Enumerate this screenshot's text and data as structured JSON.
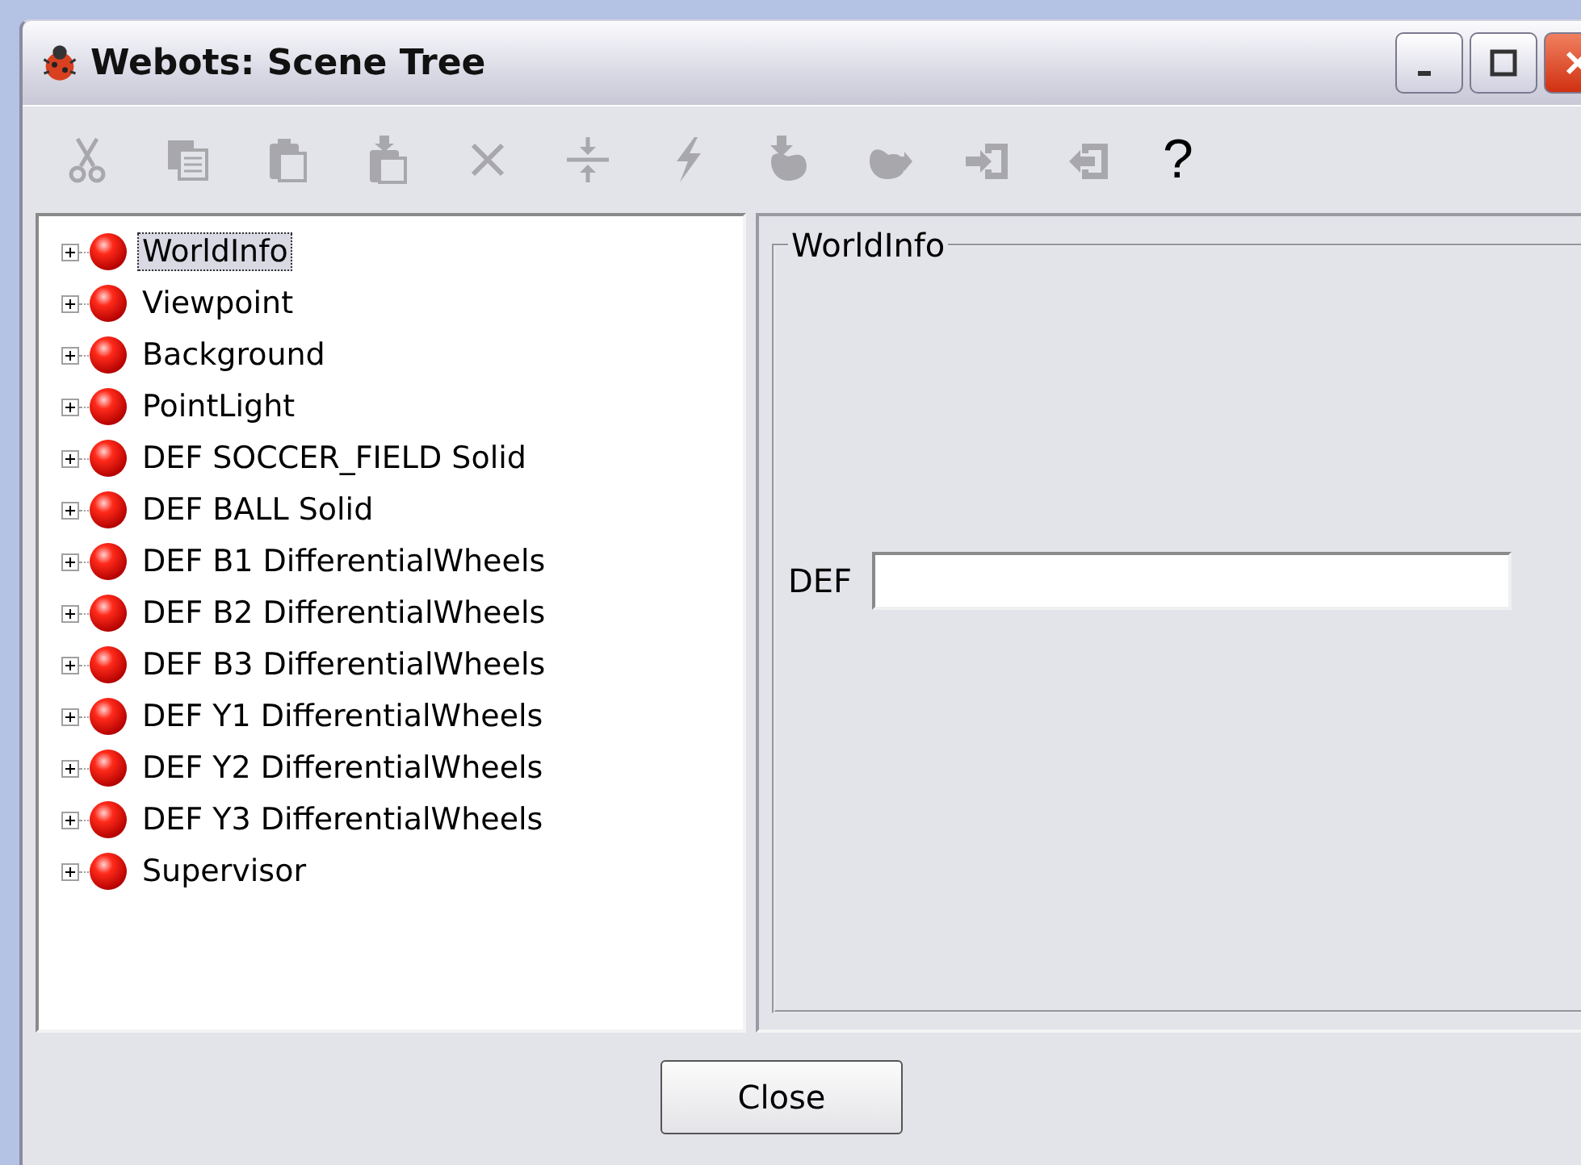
{
  "window": {
    "title": "Webots: Scene Tree"
  },
  "toolbar": [
    {
      "kind": "cut",
      "disabled": true
    },
    {
      "kind": "copy",
      "disabled": true
    },
    {
      "kind": "paste",
      "disabled": true
    },
    {
      "kind": "paste-after",
      "disabled": true
    },
    {
      "kind": "delete",
      "disabled": true
    },
    {
      "kind": "reset",
      "disabled": true
    },
    {
      "kind": "transform",
      "disabled": true
    },
    {
      "kind": "import",
      "disabled": true
    },
    {
      "kind": "export",
      "disabled": true
    },
    {
      "kind": "enter",
      "disabled": true
    },
    {
      "kind": "leave",
      "disabled": true
    },
    {
      "kind": "text",
      "label": "?",
      "disabled": false
    }
  ],
  "tree": [
    {
      "label": "WorldInfo",
      "expanded": false,
      "selected": true
    },
    {
      "label": "Viewpoint",
      "expanded": false,
      "selected": false
    },
    {
      "label": "Background",
      "expanded": false,
      "selected": false
    },
    {
      "label": "PointLight",
      "expanded": false,
      "selected": false
    },
    {
      "label": "DEF SOCCER_FIELD Solid",
      "expanded": false,
      "selected": false
    },
    {
      "label": "DEF BALL Solid",
      "expanded": false,
      "selected": false
    },
    {
      "label": "DEF B1 DifferentialWheels",
      "expanded": false,
      "selected": false
    },
    {
      "label": "DEF B2 DifferentialWheels",
      "expanded": false,
      "selected": false
    },
    {
      "label": "DEF B3 DifferentialWheels",
      "expanded": false,
      "selected": false
    },
    {
      "label": "DEF Y1 DifferentialWheels",
      "expanded": false,
      "selected": false
    },
    {
      "label": "DEF Y2 DifferentialWheels",
      "expanded": false,
      "selected": false
    },
    {
      "label": "DEF Y3 DifferentialWheels",
      "expanded": false,
      "selected": false
    },
    {
      "label": "Supervisor",
      "expanded": false,
      "selected": false
    }
  ],
  "details": {
    "group_title": "WorldInfo",
    "def_label": "DEF"
  },
  "buttons": [
    "Close"
  ]
}
